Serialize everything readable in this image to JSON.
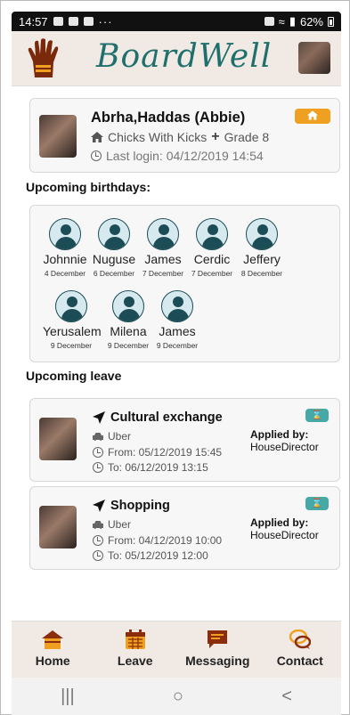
{
  "status_bar": {
    "time": "14:57",
    "dots": "···",
    "battery": "62%"
  },
  "header": {
    "logo_text": "BoardWell"
  },
  "profile": {
    "name": "Abrha,Haddas (Abbie)",
    "house": "Chicks With Kicks",
    "grade": "Grade 8",
    "last_login": "Last login: 04/12/2019 14:54"
  },
  "birthdays": {
    "title": "Upcoming birthdays:",
    "people": [
      {
        "name": "Johnnie",
        "date": "4 December"
      },
      {
        "name": "Nuguse",
        "date": "6 December"
      },
      {
        "name": "James",
        "date": "7 December"
      },
      {
        "name": "Cerdic",
        "date": "7 December"
      },
      {
        "name": "Jeffery",
        "date": "8 December"
      },
      {
        "name": "Yerusalem",
        "date": "9 December"
      },
      {
        "name": "Milena",
        "date": "9 December"
      },
      {
        "name": "James",
        "date": "9 December"
      }
    ]
  },
  "leave": {
    "title": "Upcoming leave",
    "items": [
      {
        "title": "Cultural exchange",
        "transport": "Uber",
        "from": "From: 05/12/2019 15:45",
        "to": "To: 06/12/2019 13:15",
        "applied_label": "Applied by:",
        "applied_by": "HouseDirector"
      },
      {
        "title": "Shopping",
        "transport": "Uber",
        "from": "From: 04/12/2019 10:00",
        "to": "To: 05/12/2019 12:00",
        "applied_label": "Applied by:",
        "applied_by": "HouseDirector"
      }
    ]
  },
  "nav": {
    "home": "Home",
    "leave": "Leave",
    "messaging": "Messaging",
    "contact": "Contact"
  },
  "system_nav": {
    "recents": "|||",
    "home": "○",
    "back": "<"
  },
  "colors": {
    "teal": "#1f6f6c",
    "orange": "#f0a020",
    "brown": "#8b4513",
    "header_bg": "#f1e9e4"
  }
}
